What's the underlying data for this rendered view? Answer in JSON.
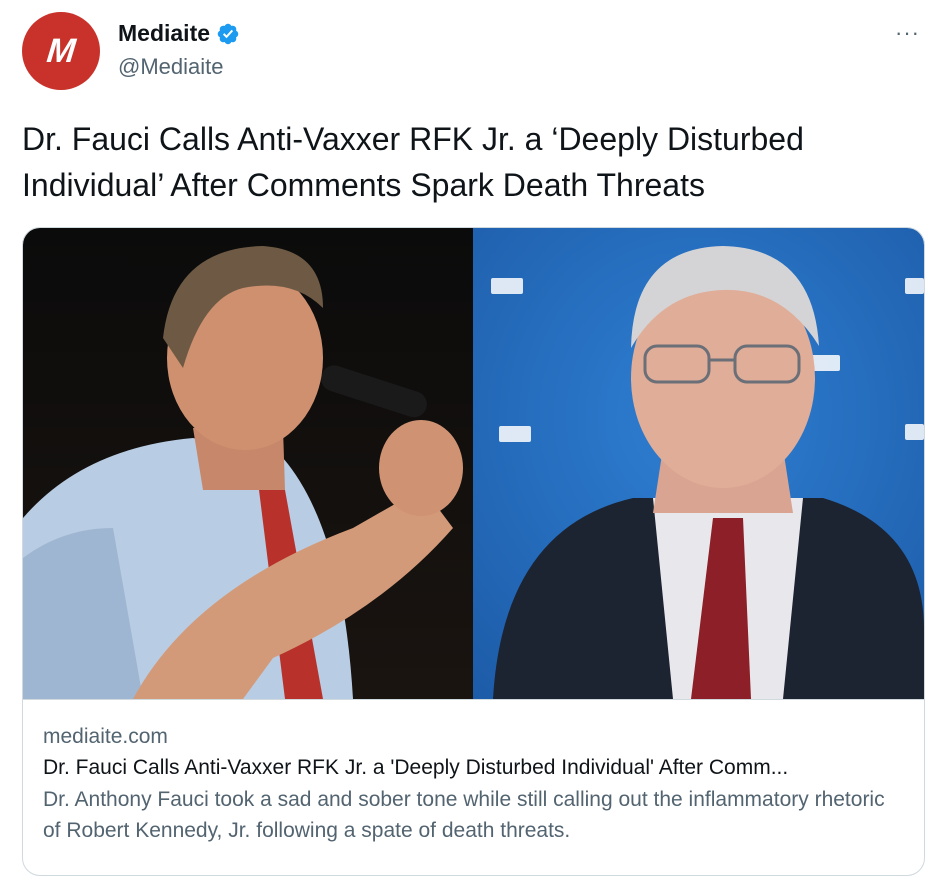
{
  "author": {
    "avatar_letter": "M",
    "avatar_color": "#c8322a",
    "display_name": "Mediaite",
    "handle": "@Mediaite",
    "verified_icon": "verified-badge-icon",
    "verified_color": "#1d9bf0"
  },
  "more_icon": "more-icon",
  "more_label": "···",
  "tweet": {
    "text": "Dr. Fauci Calls Anti-Vaxxer RFK Jr. a ‘Deeply Disturbed Individual’ After Comments Spark Death Threats"
  },
  "card": {
    "image_left": "RFK Jr. speaking into microphone",
    "image_right": "Dr. Fauci on NIH backdrop",
    "nih_logo_text": "NIH",
    "domain": "mediaite.com",
    "title": "Dr. Fauci Calls Anti-Vaxxer RFK Jr. a 'Deeply Disturbed Individual' After Comm...",
    "description": "Dr. Anthony Fauci took a sad and sober tone while still calling out the inflammatory rhetoric of Robert Kennedy, Jr. following a spate of death threats."
  }
}
